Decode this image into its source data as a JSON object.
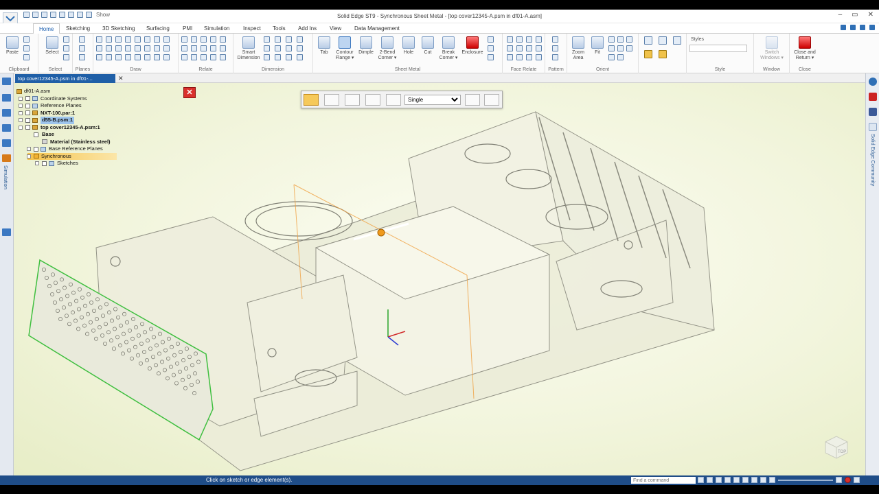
{
  "window": {
    "title": "Solid Edge ST9 - Synchronous Sheet Metal - [top cover12345-A.psm in df01-A.asm]",
    "qat_show": "Show",
    "controls": [
      "–",
      "▭",
      "✕"
    ]
  },
  "tabs": [
    "Home",
    "Sketching",
    "3D Sketching",
    "Surfacing",
    "PMI",
    "Simulation",
    "Inspect",
    "Tools",
    "Add Ins",
    "View",
    "Data Management"
  ],
  "ribbon": {
    "clipboard": {
      "group": "Clipboard",
      "paste": "Paste"
    },
    "select": {
      "group": "Select",
      "select": "Select"
    },
    "planes": {
      "group": "Planes"
    },
    "draw": {
      "group": "Draw"
    },
    "relate": {
      "group": "Relate"
    },
    "dimension": {
      "group": "Dimension",
      "smart": "Smart",
      "smart2": "Dimension"
    },
    "sheet_metal": {
      "group": "Sheet Metal",
      "tab": "Tab",
      "contour": "Contour",
      "contour2": "Flange ▾",
      "dimple": "Dimple",
      "bend": "2-Bend",
      "bend2": "Corner ▾",
      "hole": "Hole",
      "cut": "Cut",
      "break": "Break",
      "break2": "Corner ▾",
      "enclosure": "Enclosure"
    },
    "face_relate": {
      "group": "Face Relate"
    },
    "pattern": {
      "group": "Pattern"
    },
    "orient": {
      "group": "Orient",
      "zoom": "Zoom",
      "zoom2": "Area",
      "fit": "Fit"
    },
    "style": {
      "group": "Style",
      "styles": "Styles"
    },
    "window": {
      "group": "Window",
      "switch": "Switch",
      "switch2": "Windows ▾"
    },
    "close": {
      "group": "Close",
      "close": "Close and",
      "close2": "Return ▾"
    }
  },
  "document_tab": "top cover12345-A.psm in df01-...",
  "tree": {
    "root": "df01-A.asm",
    "items": [
      "Coordinate Systems",
      "Reference Planes",
      "NXT-100.par:1",
      "d55-B.psm:1",
      "top cover12345-A.psm:1",
      "Base",
      "Material (Stainless steel)",
      "Base Reference Planes",
      "Synchronous",
      "Sketches"
    ]
  },
  "command_bar": {
    "mode": "Single"
  },
  "left_bar_label": "Simulation",
  "right_bar_label": "Solid Edge Community",
  "status": {
    "prompt": "Click on sketch or edge element(s).",
    "find_placeholder": "Find a command"
  },
  "view_cube": "TOP",
  "colors": {
    "accent": "#1f5fa7",
    "status_bar": "#1f4d88",
    "close_red": "#d9302c",
    "sync_highlight": "#f5c34d"
  }
}
